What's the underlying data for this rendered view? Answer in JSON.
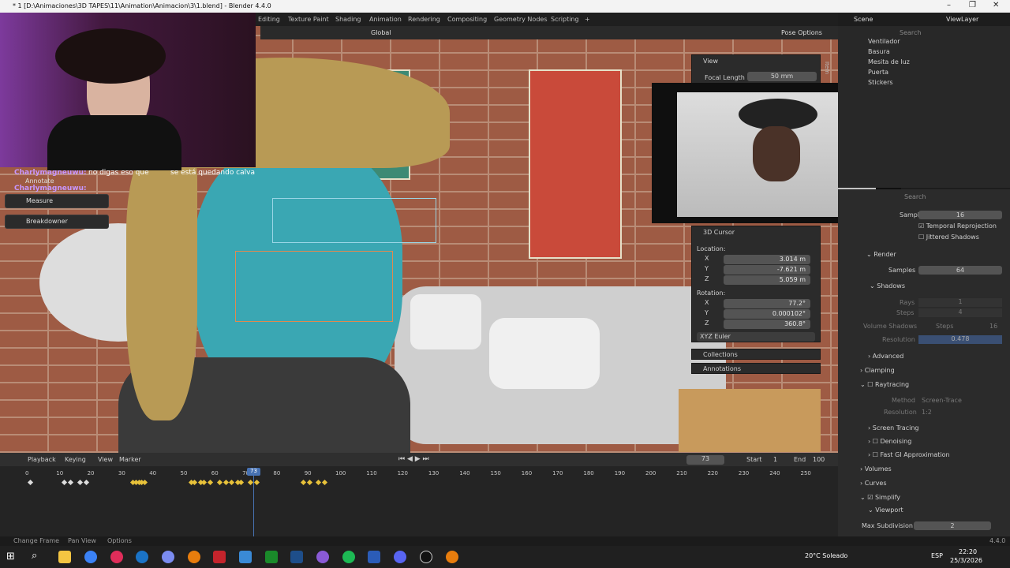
{
  "titlebar": {
    "title": "* 1 [D:\\Animaciones\\3D TAPES\\11\\Animation\\Animacion\\3\\1.blend] - Blender 4.4.0"
  },
  "menubar": {
    "tabs": [
      "Editing",
      "Texture Paint",
      "Shading",
      "Animation",
      "Rendering",
      "Compositing",
      "Geometry Nodes",
      "Scripting",
      "+"
    ]
  },
  "header3d": {
    "orientation": "Global",
    "pose_options": "Pose Options"
  },
  "scene": {
    "scene_label": "Scene",
    "viewlayer_label": "ViewLayer"
  },
  "chat": {
    "user1": "Charlymagneuwu:",
    "msg1": "no digas eso que",
    "msg1b": "se está quedando calva",
    "user2": "Charlymagneuwu:"
  },
  "tools": [
    "Annotate",
    "Measure",
    "Breakdowner"
  ],
  "npanel": {
    "view_title": "View",
    "focal_label": "Focal Length",
    "focal_value": "50 mm",
    "cursor_title": "3D Cursor",
    "location": "Location:",
    "loc": [
      {
        "axis": "X",
        "val": "3.014 m"
      },
      {
        "axis": "Y",
        "val": "-7.621 m"
      },
      {
        "axis": "Z",
        "val": "5.059 m"
      }
    ],
    "rotation": "Rotation:",
    "rot": [
      {
        "axis": "X",
        "val": "77.2°"
      },
      {
        "axis": "Y",
        "val": "0.000102°"
      },
      {
        "axis": "Z",
        "val": "360.8°"
      }
    ],
    "euler": "XYZ Euler",
    "collections": "Collections",
    "annotations": "Annotations",
    "side_tab": "Item"
  },
  "outliner": {
    "search": "Search",
    "items": [
      "Ventilador",
      "Basura",
      "Mesita de luz",
      "Puerta",
      "Stickers"
    ]
  },
  "props": {
    "search": "Search",
    "samples_top_label": "Samples",
    "samples_top": "16",
    "temporal": "Temporal Reprojection",
    "jittered": "Jittered Shadows",
    "render": "Render",
    "samples_label": "Samples",
    "samples": "64",
    "shadows": "Shadows",
    "rays_label": "Rays",
    "rays": "1",
    "steps_label": "Steps",
    "steps": "4",
    "vol_label": "Volume Shadows",
    "vol_steps_label": "Steps",
    "vol_steps": "16",
    "res_label": "Resolution",
    "res": "0.478",
    "advanced": "Advanced",
    "clamping": "Clamping",
    "raytracing": "Raytracing",
    "method_label": "Method",
    "method": "Screen-Trace",
    "rt_res_label": "Resolution",
    "rt_res": "1:2",
    "screen_tracing": "Screen Tracing",
    "denoising": "Denoising",
    "fastgi": "Fast GI Approximation",
    "volumes": "Volumes",
    "curves": "Curves",
    "simplify": "Simplify",
    "viewport": "Viewport",
    "maxsub_label": "Max Subdivision",
    "maxsub": "2"
  },
  "timeline": {
    "menus": [
      "Playback",
      "Keying",
      "View",
      "Marker"
    ],
    "current": "73",
    "start_label": "Start",
    "start": "1",
    "end_label": "End",
    "end": "100",
    "ticks": [
      "0",
      "10",
      "20",
      "30",
      "40",
      "50",
      "60",
      "70",
      "80",
      "90",
      "100",
      "110",
      "120",
      "130",
      "140",
      "150",
      "160",
      "170",
      "180",
      "190",
      "200",
      "210",
      "220",
      "230",
      "240",
      "250"
    ],
    "playhead": "73"
  },
  "status": {
    "change_frame": "Change Frame",
    "pan_view": "Pan View",
    "options": "Options",
    "version": "4.4.0"
  },
  "taskbar": {
    "weather": "20°C Soleado",
    "lang": "ESP",
    "time": "22:20",
    "date": "25/3/2026"
  },
  "colors": {
    "accent": "#4772b3",
    "keyframe": "#e8c23a",
    "playhead": "#4772b3"
  }
}
